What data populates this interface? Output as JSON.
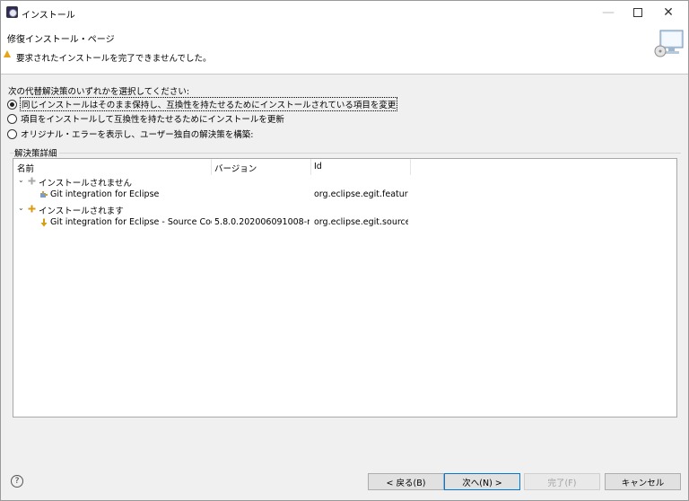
{
  "window": {
    "title": "インストール"
  },
  "banner": {
    "title": "修復インストール・ページ",
    "message": "要求されたインストールを完了できませんでした。"
  },
  "options": {
    "prompt": "次の代替解決策のいずれかを選択してください:",
    "items": [
      {
        "label": "同じインストールはそのまま保持し、互換性を持たせるためにインストールされている項目を変更",
        "selected": true
      },
      {
        "label": "項目をインストールして互換性を持たせるためにインストールを更新",
        "selected": false
      },
      {
        "label": "オリジナル・エラーを表示し、ユーザー独自の解決策を構築:",
        "selected": false
      }
    ]
  },
  "details": {
    "group_label": "解決策詳細",
    "columns": [
      "名前",
      "バージョン",
      "Id"
    ],
    "rows": [
      {
        "name": "インストールされません",
        "version": "",
        "id": "",
        "level": 0
      },
      {
        "name": "Git integration for Eclipse",
        "version": "",
        "id": "org.eclipse.egit.feature...",
        "level": 1
      },
      {
        "name": "インストールされます",
        "version": "",
        "id": "",
        "level": 0
      },
      {
        "name": "Git integration for Eclipse - Source Code",
        "version": "5.8.0.202006091008-r",
        "id": "org.eclipse.egit.source....",
        "level": 1
      }
    ]
  },
  "footer": {
    "help": "?",
    "back": "< 戻る(B)",
    "next": "次へ(N) >",
    "finish": "完了(F)",
    "cancel": "キャンセル"
  },
  "colors": {
    "accent": "#0078d7",
    "warning": "#e8a317"
  }
}
